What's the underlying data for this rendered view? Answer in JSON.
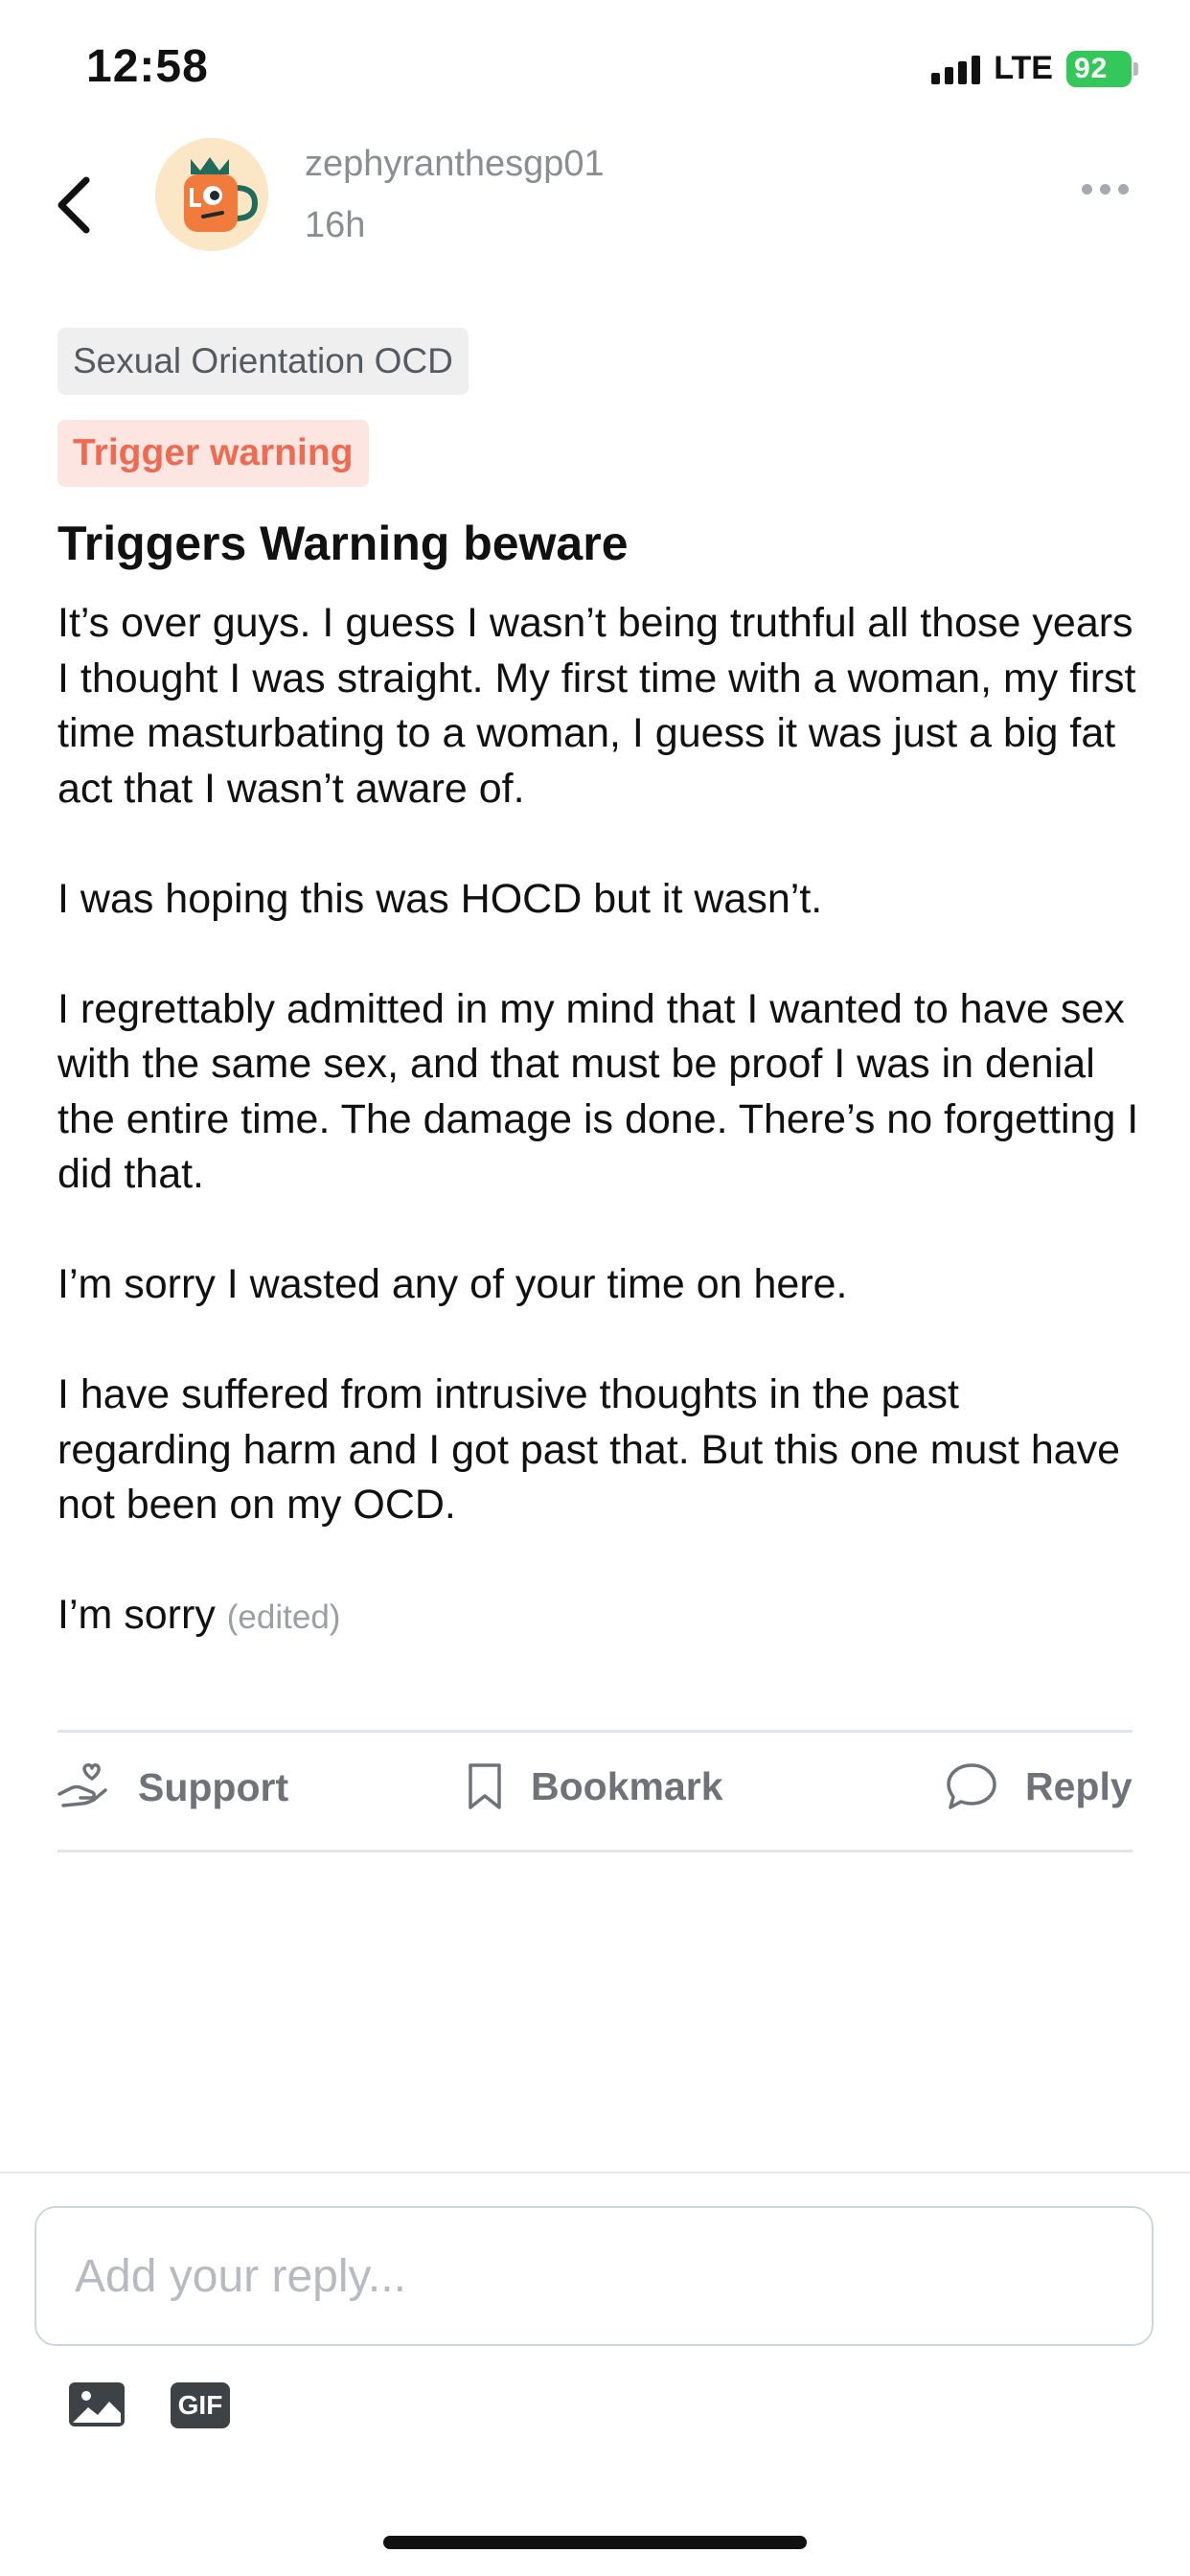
{
  "status_bar": {
    "time": "12:58",
    "network": "LTE",
    "battery": "92"
  },
  "header": {
    "username": "zephyranthesgp01",
    "timestamp": "16h",
    "back_icon": "chevron-left-icon",
    "more_icon": "more-horizontal-icon"
  },
  "post": {
    "category": "Sexual Orientation OCD",
    "warning_label": "Trigger warning",
    "title": "Triggers Warning beware",
    "paragraphs": [
      "It’s over guys. I guess I wasn’t being truthful all those years I thought I was straight. My first time with a woman, my first time masturbating to a woman, I guess it was just a big fat act that I wasn’t aware of.",
      "I was hoping this was HOCD but it wasn’t.",
      "I regrettably admitted in my mind that I wanted to have sex with the same sex, and that must be proof I was in denial the entire time. The damage is done. There’s no forgetting I did that.",
      "I’m sorry I wasted any of your time on here.",
      "I have suffered from intrusive thoughts in the past regarding harm and I got past that. But this one must have not been on my OCD.",
      "I’m sorry"
    ],
    "edited_label": "(edited)"
  },
  "actions": {
    "support": "Support",
    "bookmark": "Bookmark",
    "reply": "Reply"
  },
  "composer": {
    "placeholder": "Add your reply...",
    "gif_label": "GIF"
  },
  "colors": {
    "warning_text": "#ee6b52",
    "warning_bg": "#fde6e2",
    "battery": "#34c759",
    "muted": "#8a8d91"
  }
}
